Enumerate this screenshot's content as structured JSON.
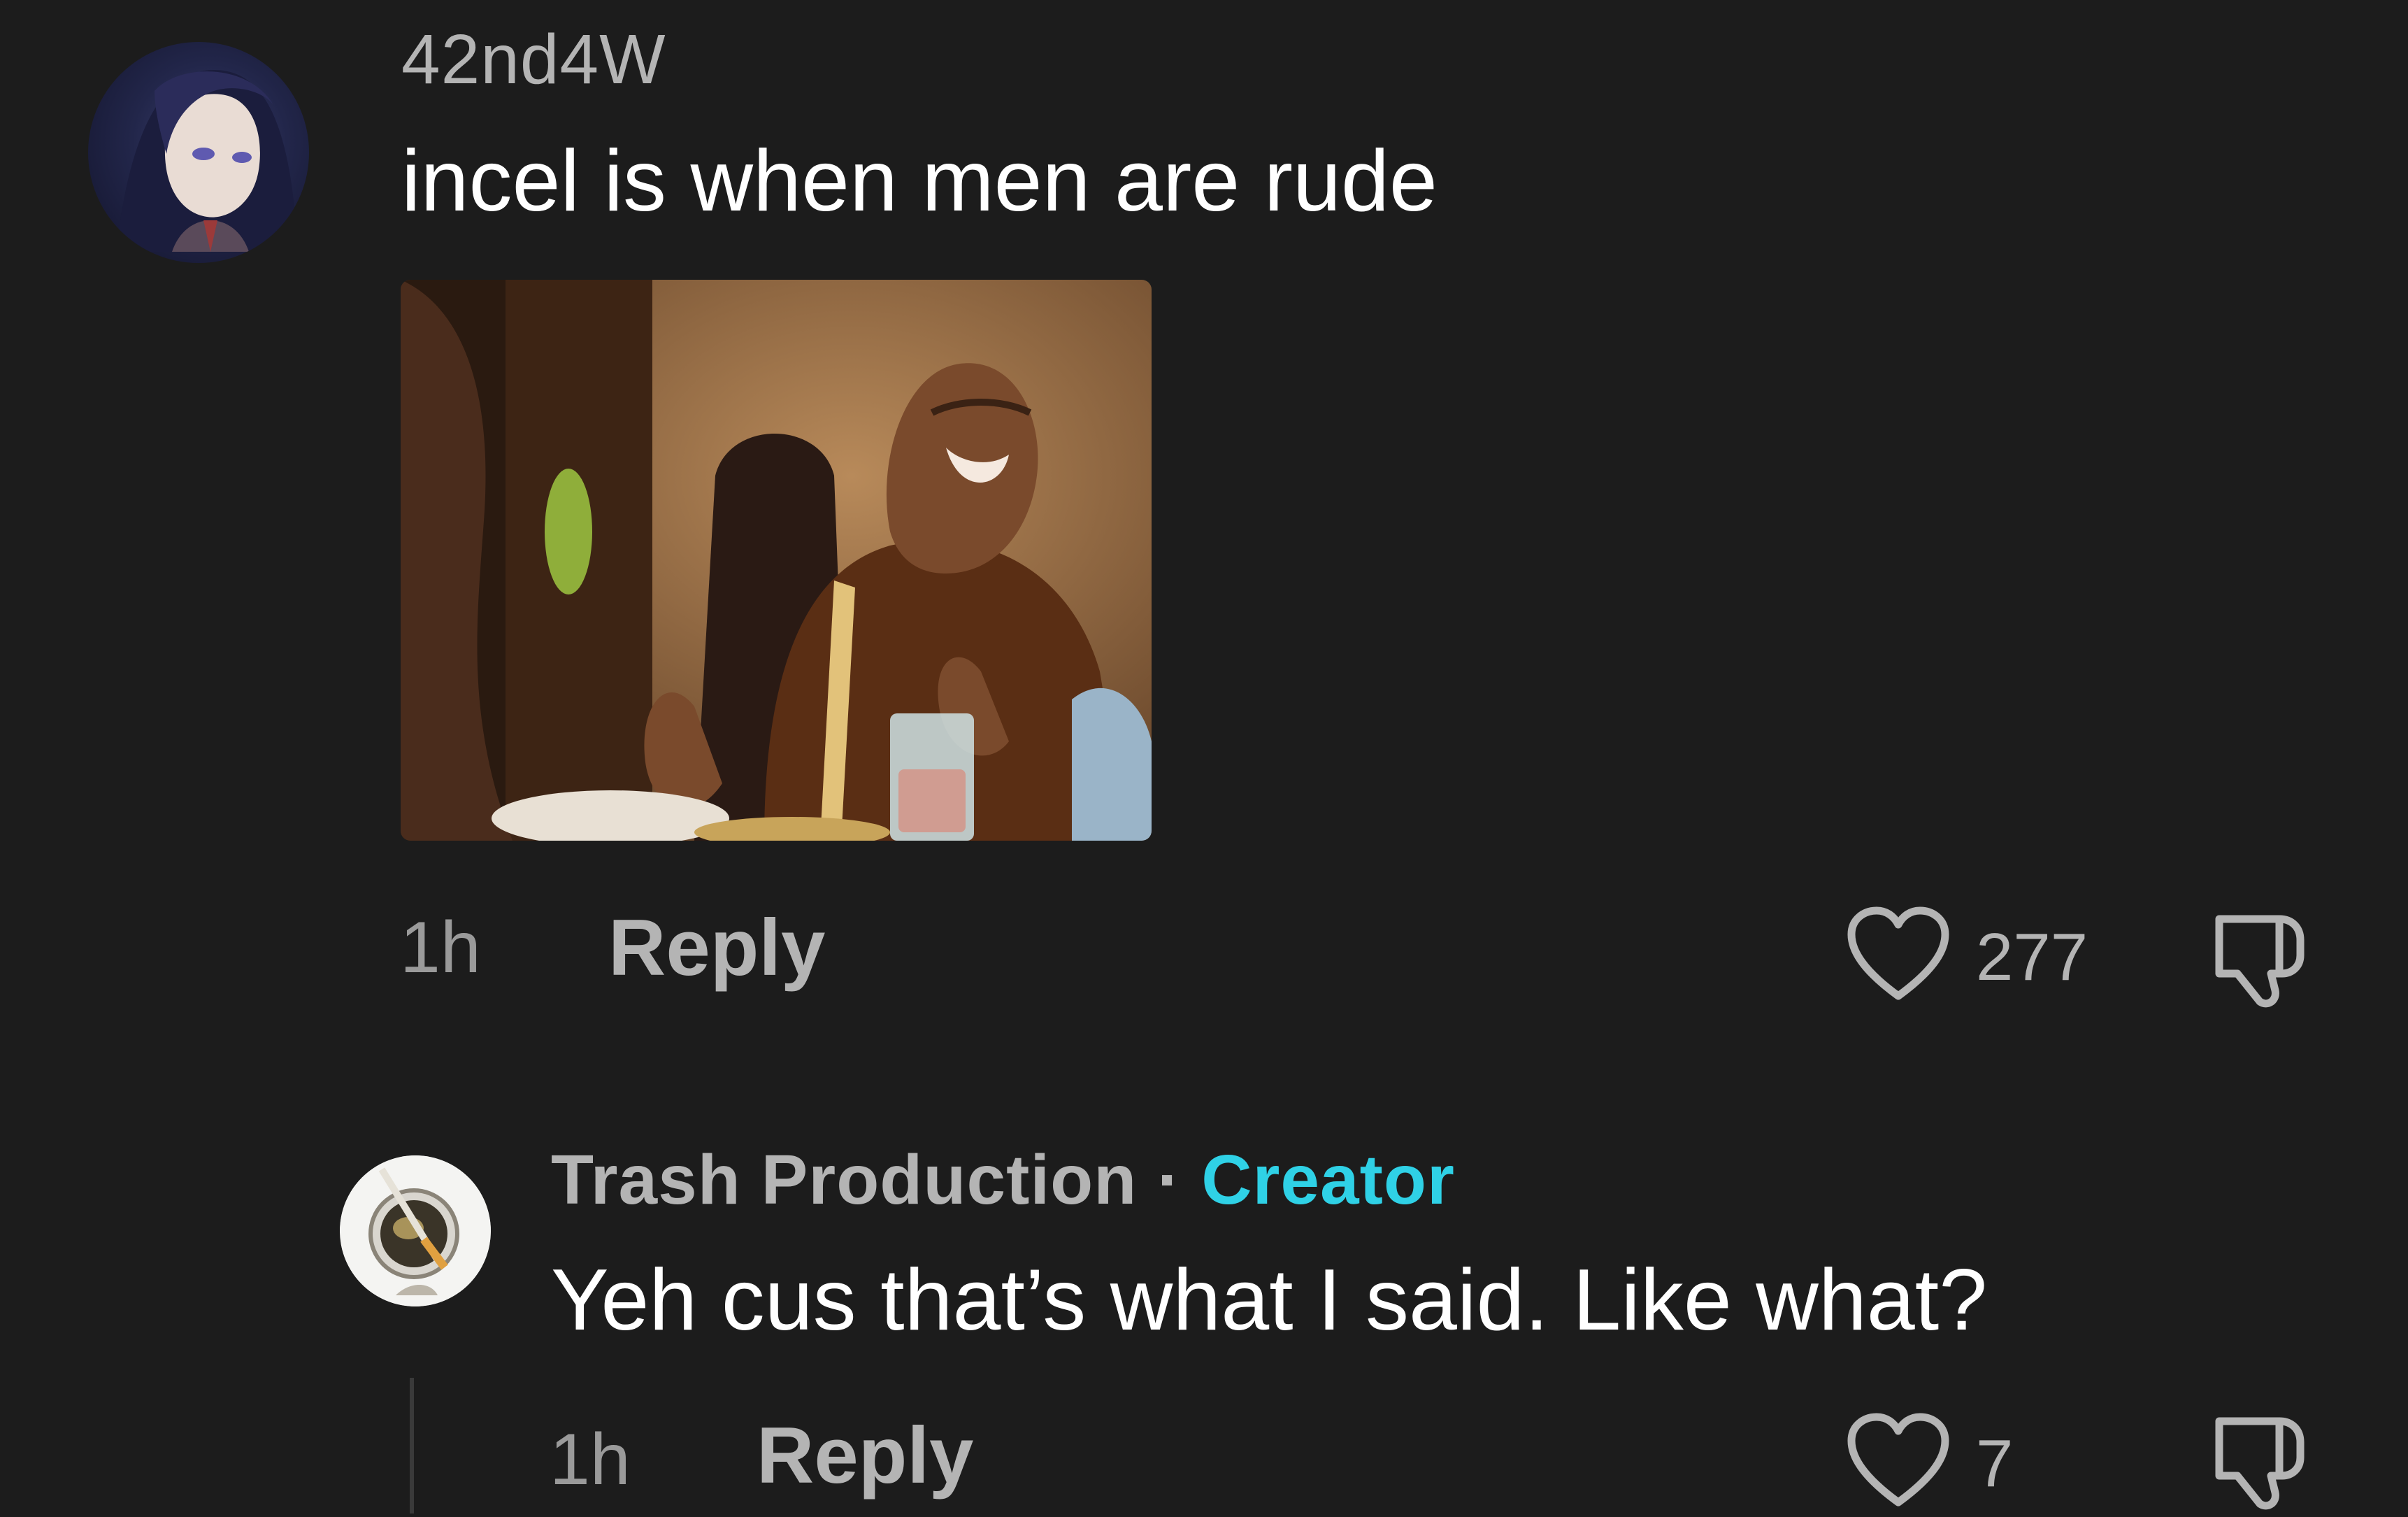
{
  "comment": {
    "username": "42nd4W",
    "text": "incel is when men are rude",
    "media": "laughing-man-gif",
    "time": "1h",
    "reply_label": "Reply",
    "like_count": "277",
    "icons": {
      "like": "heart-icon",
      "dislike": "thumbs-down-icon"
    }
  },
  "reply": {
    "username": "Trash Production",
    "separator": "·",
    "tag": "Creator",
    "text": "Yeh cus that’s what I said. Like what?",
    "time": "1h",
    "reply_label": "Reply",
    "like_count": "7",
    "icons": {
      "like": "heart-icon",
      "dislike": "thumbs-down-icon"
    }
  },
  "colors": {
    "background": "#1c1c1c",
    "creator_accent": "#2fd1e6",
    "muted_text": "#b4b4b4"
  }
}
